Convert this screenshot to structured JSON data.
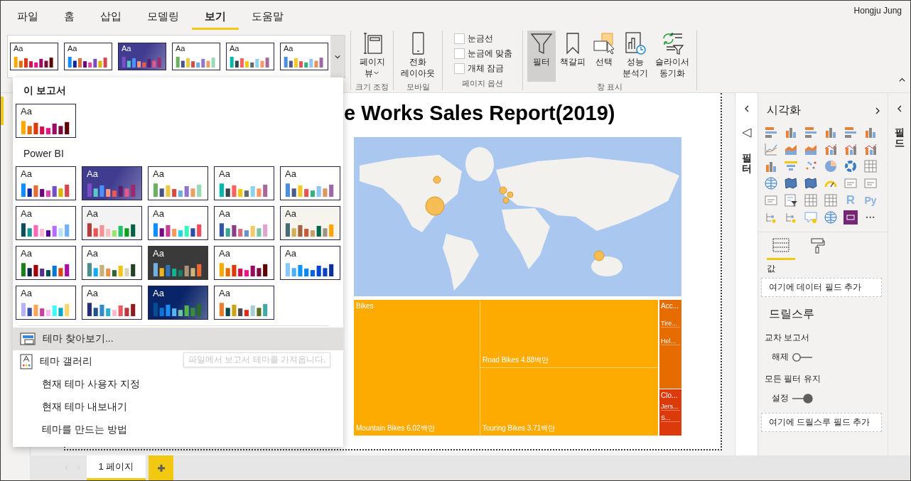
{
  "menu": {
    "tabs": [
      {
        "label": "파일",
        "selected": false
      },
      {
        "label": "홈",
        "selected": false
      },
      {
        "label": "삽입",
        "selected": false
      },
      {
        "label": "모델링",
        "selected": false
      },
      {
        "label": "보기",
        "selected": true
      },
      {
        "label": "도움말",
        "selected": false
      }
    ],
    "user": "Hongju Jung"
  },
  "ribbon": {
    "themes": [
      {
        "label": "Aa",
        "kind": "plain",
        "color": "#ffffff",
        "bars": [
          {
            "color": "#fdaa00"
          },
          {
            "color": "#e66c00"
          },
          {
            "color": "#dd3a0c"
          },
          {
            "color": "#d30f50"
          },
          {
            "color": "#ea1489"
          },
          {
            "color": "#9b0b60"
          },
          {
            "color": "#7b0a3f"
          },
          {
            "color": "#5c0002"
          }
        ]
      },
      {
        "label": "Aa",
        "kind": "plain",
        "color": "#ffffff",
        "bars": [
          {
            "color": "#118dff"
          },
          {
            "color": "#12239e"
          },
          {
            "color": "#e66c37"
          },
          {
            "color": "#6b007b"
          },
          {
            "color": "#e044a7"
          },
          {
            "color": "#744ec2"
          },
          {
            "color": "#d9b300"
          },
          {
            "color": "#d64550"
          }
        ]
      },
      {
        "label": "Aa",
        "kind": "gradient",
        "color": "#403d90",
        "bars": [
          {
            "color": "#7c4dc9"
          },
          {
            "color": "#5ac8c8"
          },
          {
            "color": "#4a90ff"
          },
          {
            "color": "#ff977e"
          },
          {
            "color": "#eb5757"
          },
          {
            "color": "#5b1f6f"
          },
          {
            "color": "#e8578c"
          },
          {
            "color": "#9c2a6c"
          }
        ]
      },
      {
        "label": "Aa",
        "kind": "plain",
        "color": "#ffffff",
        "bars": [
          {
            "color": "#6bb160"
          },
          {
            "color": "#4a5388"
          },
          {
            "color": "#ebc746"
          },
          {
            "color": "#d64b48"
          },
          {
            "color": "#6fade0"
          },
          {
            "color": "#9174d0"
          },
          {
            "color": "#e8a065"
          },
          {
            "color": "#98d9b9"
          }
        ]
      },
      {
        "label": "Aa",
        "kind": "plain",
        "color": "#ffffff",
        "bars": [
          {
            "color": "#01b8aa"
          },
          {
            "color": "#374649"
          },
          {
            "color": "#fd625e"
          },
          {
            "color": "#f2c80f"
          },
          {
            "color": "#5f6b6d"
          },
          {
            "color": "#8ad4eb"
          },
          {
            "color": "#fe9666"
          },
          {
            "color": "#a66999"
          }
        ]
      },
      {
        "label": "Aa",
        "kind": "plain",
        "color": "#ffffff",
        "bars": [
          {
            "color": "#4d8fdf"
          },
          {
            "color": "#4a5b8c"
          },
          {
            "color": "#f5c825"
          },
          {
            "color": "#e05656"
          },
          {
            "color": "#34b17f"
          },
          {
            "color": "#92c5f0"
          },
          {
            "color": "#df955e"
          },
          {
            "color": "#9c69a7"
          }
        ]
      }
    ],
    "groups": [
      {
        "label": "크기 조정",
        "kind": "buttons",
        "items": [
          {
            "kind": "page-view",
            "lines": [
              "페이지",
              "뷰"
            ],
            "dropdown": true,
            "selected": false
          }
        ]
      },
      {
        "label": "모바일",
        "kind": "buttons",
        "items": [
          {
            "kind": "phone",
            "lines": [
              "전화",
              "레이아웃"
            ],
            "dropdown": false,
            "selected": false
          }
        ]
      },
      {
        "label": "페이지 옵션",
        "kind": "checkboxes",
        "items": [
          {
            "label": "눈금선",
            "checked": false
          },
          {
            "label": "눈금에 맞춤",
            "checked": false
          },
          {
            "label": "개체 잠금",
            "checked": false
          }
        ]
      },
      {
        "label": "창 표시",
        "kind": "buttons",
        "items": [
          {
            "kind": "filter",
            "lines": [
              "필터"
            ],
            "dropdown": false,
            "selected": true
          },
          {
            "kind": "bookmark",
            "lines": [
              "책갈피"
            ],
            "dropdown": false,
            "selected": false
          },
          {
            "kind": "selection",
            "lines": [
              "선택"
            ],
            "dropdown": false,
            "selected": false
          },
          {
            "kind": "performance",
            "lines": [
              "성능",
              "분석기"
            ],
            "dropdown": false,
            "selected": false
          },
          {
            "kind": "sync",
            "lines": [
              "슬라이서",
              "동기화"
            ],
            "dropdown": false,
            "selected": false
          }
        ]
      }
    ]
  },
  "page": {
    "title": "e Works Sales Report(2019)",
    "treemap": {
      "groups": [
        {
          "label": "Bikes",
          "color": "#fdab00",
          "tiles": [
            "Mountain Bikes 6.02백만",
            "Road Bikes 4.88백만",
            "Touring Bikes 3.71백만"
          ]
        },
        {
          "label": "Acc...",
          "color": "#e66c00",
          "tiles": [
            "Tire...",
            "Hel..."
          ]
        },
        {
          "label": "Clo...",
          "color": "#dd3a0c",
          "tiles": [
            "Jers...",
            "S..."
          ]
        }
      ]
    }
  },
  "filters_pane": {
    "label": "필터"
  },
  "visualizations": {
    "title": "시각화",
    "icons": [
      {
        "kind": "hbar"
      },
      {
        "kind": "vbar"
      },
      {
        "kind": "hbar"
      },
      {
        "kind": "vbar"
      },
      {
        "kind": "hbar"
      },
      {
        "kind": "vbar"
      },
      {
        "kind": "line"
      },
      {
        "kind": "area"
      },
      {
        "kind": "area"
      },
      {
        "kind": "combo"
      },
      {
        "kind": "combo"
      },
      {
        "kind": "combo"
      },
      {
        "kind": "vbar"
      },
      {
        "kind": "funnel"
      },
      {
        "kind": "scatter"
      },
      {
        "kind": "pie"
      },
      {
        "kind": "donut"
      },
      {
        "kind": "grid"
      },
      {
        "kind": "globe"
      },
      {
        "kind": "map"
      },
      {
        "kind": "map"
      },
      {
        "kind": "gauge"
      },
      {
        "kind": "card"
      },
      {
        "kind": "card"
      },
      {
        "kind": "card"
      },
      {
        "kind": "slicer"
      },
      {
        "kind": "grid"
      },
      {
        "kind": "grid"
      },
      {
        "kind": "letter",
        "text": "R"
      },
      {
        "kind": "letter",
        "text": "Py"
      },
      {
        "kind": "tree"
      },
      {
        "kind": "tree"
      },
      {
        "kind": "speech"
      },
      {
        "kind": "globe"
      },
      {
        "kind": "custom"
      },
      {
        "kind": "letter",
        "text": "···"
      }
    ],
    "tabs": [
      {
        "kind": "fields",
        "selected": true
      },
      {
        "kind": "format",
        "selected": false
      }
    ],
    "values_label": "값",
    "values_hint": "여기에 데이터 필드 추가",
    "drillthrough": {
      "title": "드릴스루",
      "toggles": [
        {
          "label": "교차 보고서",
          "state": "해제",
          "on": false
        },
        {
          "label": "모든 필터 유지",
          "state": "설정",
          "on": true
        }
      ],
      "hint": "여기에 드릴스루 필드 추가"
    }
  },
  "fields_pane": {
    "label": "필드"
  },
  "page_tabs": {
    "tabs": [
      {
        "label": "1 페이지",
        "selected": true
      }
    ]
  },
  "theme_menu": {
    "sections": [
      {
        "title": "이 보고서",
        "themes": [
          {
            "label": "Aa",
            "kind": "plain",
            "color": "#ffffff",
            "bars": [
              {
                "color": "#fdaa00"
              },
              {
                "color": "#e66c00"
              },
              {
                "color": "#dd3a0c"
              },
              {
                "color": "#d30f50"
              },
              {
                "color": "#ea1489"
              },
              {
                "color": "#9b0b60"
              },
              {
                "color": "#7b0a3f"
              },
              {
                "color": "#5c0002"
              }
            ]
          }
        ]
      },
      {
        "title": "Power BI",
        "themes": [
          {
            "label": "Aa",
            "kind": "plain",
            "color": "#ffffff",
            "bars": [
              {
                "color": "#118dff"
              },
              {
                "color": "#12239e"
              },
              {
                "color": "#e66c37"
              },
              {
                "color": "#6b007b"
              },
              {
                "color": "#e044a7"
              },
              {
                "color": "#744ec2"
              },
              {
                "color": "#d9b300"
              },
              {
                "color": "#d64550"
              }
            ]
          },
          {
            "label": "Aa",
            "kind": "gradient",
            "color": "#403d90",
            "bars": [
              {
                "color": "#7c4dc9"
              },
              {
                "color": "#5ac8c8"
              },
              {
                "color": "#4a90ff"
              },
              {
                "color": "#ff977e"
              },
              {
                "color": "#eb5757"
              },
              {
                "color": "#5b1f6f"
              },
              {
                "color": "#e8578c"
              },
              {
                "color": "#9c2a6c"
              }
            ]
          },
          {
            "label": "Aa",
            "kind": "plain",
            "color": "#ffffff",
            "bars": [
              {
                "color": "#6bb160"
              },
              {
                "color": "#4a5388"
              },
              {
                "color": "#ebc746"
              },
              {
                "color": "#d64b48"
              },
              {
                "color": "#6fade0"
              },
              {
                "color": "#9174d0"
              },
              {
                "color": "#e8a065"
              },
              {
                "color": "#98d9b9"
              }
            ]
          },
          {
            "label": "Aa",
            "kind": "plain",
            "color": "#ffffff",
            "bars": [
              {
                "color": "#01b8aa"
              },
              {
                "color": "#374649"
              },
              {
                "color": "#fd625e"
              },
              {
                "color": "#f2c80f"
              },
              {
                "color": "#5f6b6d"
              },
              {
                "color": "#8ad4eb"
              },
              {
                "color": "#fe9666"
              },
              {
                "color": "#a66999"
              }
            ]
          },
          {
            "label": "Aa",
            "kind": "plain",
            "color": "#ffffff",
            "bars": [
              {
                "color": "#4d8fdf"
              },
              {
                "color": "#4a5b8c"
              },
              {
                "color": "#f5c825"
              },
              {
                "color": "#e05656"
              },
              {
                "color": "#34b17f"
              },
              {
                "color": "#92c5f0"
              },
              {
                "color": "#df955e"
              },
              {
                "color": "#9c69a7"
              }
            ]
          },
          {
            "label": "Aa",
            "kind": "plain",
            "color": "#ffffff",
            "bars": [
              {
                "color": "#0f4c5c"
              },
              {
                "color": "#0e9594"
              },
              {
                "color": "#fe66bb"
              },
              {
                "color": "#f9b6d4"
              },
              {
                "color": "#4f0795"
              },
              {
                "color": "#b46efb"
              },
              {
                "color": "#bee1fd"
              },
              {
                "color": "#6fb2fd"
              }
            ]
          },
          {
            "label": "Aa",
            "kind": "plain",
            "color": "#f3f3f3",
            "bars": [
              {
                "color": "#b33c3e"
              },
              {
                "color": "#ec5354"
              },
              {
                "color": "#f39194"
              },
              {
                "color": "#f7bfbe"
              },
              {
                "color": "#9ae46c"
              },
              {
                "color": "#24c06b"
              },
              {
                "color": "#0aa01a"
              },
              {
                "color": "#066046"
              }
            ]
          },
          {
            "label": "Aa",
            "kind": "plain",
            "color": "#ffffff",
            "bars": [
              {
                "color": "#118dff"
              },
              {
                "color": "#750985"
              },
              {
                "color": "#c83d95"
              },
              {
                "color": "#ff985e"
              },
              {
                "color": "#1ddae6"
              },
              {
                "color": "#3bf5c1"
              },
              {
                "color": "#2f4bac"
              },
              {
                "color": "#f04e5e"
              }
            ]
          },
          {
            "label": "Aa",
            "kind": "plain",
            "color": "#ffffff",
            "bars": [
              {
                "color": "#3257a8"
              },
              {
                "color": "#37a794"
              },
              {
                "color": "#8b3d88"
              },
              {
                "color": "#dd6b7f"
              },
              {
                "color": "#6b91c9"
              },
              {
                "color": "#f5c869"
              },
              {
                "color": "#77c4a8"
              },
              {
                "color": "#dea6cf"
              }
            ]
          },
          {
            "label": "Aa",
            "kind": "plain",
            "color": "#f6f4ed",
            "bars": [
              {
                "color": "#486a76"
              },
              {
                "color": "#d1b155"
              },
              {
                "color": "#a3633f"
              },
              {
                "color": "#c55a3a"
              },
              {
                "color": "#c39e6c"
              },
              {
                "color": "#01684d"
              },
              {
                "color": "#9f9286"
              },
              {
                "color": "#ffa500"
              }
            ]
          },
          {
            "label": "Aa",
            "kind": "plain",
            "color": "#ffffff",
            "bars": [
              {
                "color": "#1b7f1b"
              },
              {
                "color": "#0c2449"
              },
              {
                "color": "#a10008"
              },
              {
                "color": "#5b2c90"
              },
              {
                "color": "#04524d"
              },
              {
                "color": "#0b78d0"
              },
              {
                "color": "#dd4a0f"
              },
              {
                "color": "#a80da6"
              }
            ]
          },
          {
            "label": "Aa",
            "kind": "plain",
            "color": "#ffffff",
            "bars": [
              {
                "color": "#4a8e8e"
              },
              {
                "color": "#14aaf5"
              },
              {
                "color": "#c6b07c"
              },
              {
                "color": "#ef904a"
              },
              {
                "color": "#336235"
              },
              {
                "color": "#f2c515"
              },
              {
                "color": "#d8d4bc"
              },
              {
                "color": "#224226"
              }
            ]
          },
          {
            "label": "Aa",
            "kind": "plain",
            "color": "#3a3a3a",
            "bars": [
              {
                "color": "#73b0e0"
              },
              {
                "color": "#f2b31a"
              },
              {
                "color": "#2e75b8"
              },
              {
                "color": "#13b092"
              },
              {
                "color": "#128061"
              },
              {
                "color": "#ad937a"
              },
              {
                "color": "#ccb57f"
              },
              {
                "color": "#f36730"
              }
            ]
          },
          {
            "label": "Aa",
            "kind": "plain",
            "color": "#ffffff",
            "bars": [
              {
                "color": "#fdaa00"
              },
              {
                "color": "#e66c00"
              },
              {
                "color": "#dd3a0c"
              },
              {
                "color": "#d30f50"
              },
              {
                "color": "#ea1489"
              },
              {
                "color": "#9b0b60"
              },
              {
                "color": "#7b0a3f"
              },
              {
                "color": "#5c0002"
              }
            ]
          },
          {
            "label": "Aa",
            "kind": "plain",
            "color": "#ffffff",
            "bars": [
              {
                "color": "#8ac6ff"
              },
              {
                "color": "#48b1ff"
              },
              {
                "color": "#0d94ff"
              },
              {
                "color": "#0a86ec"
              },
              {
                "color": "#0064e6"
              },
              {
                "color": "#0448cf"
              },
              {
                "color": "#0a42c1"
              },
              {
                "color": "#0e2f9b"
              }
            ]
          },
          {
            "label": "Aa",
            "kind": "plain",
            "color": "#ffffff",
            "bars": [
              {
                "color": "#b8b2fb"
              },
              {
                "color": "#344da9"
              },
              {
                "color": "#fca458"
              },
              {
                "color": "#c8409c"
              },
              {
                "color": "#fabaec"
              },
              {
                "color": "#3ef9f6"
              },
              {
                "color": "#05a7c4"
              },
              {
                "color": "#fdd46a"
              }
            ]
          },
          {
            "label": "Aa",
            "kind": "plain",
            "color": "#ffffff",
            "bars": [
              {
                "color": "#292e7b"
              },
              {
                "color": "#21548d"
              },
              {
                "color": "#318bcb"
              },
              {
                "color": "#29b0d3"
              },
              {
                "color": "#fdbdce"
              },
              {
                "color": "#ec5a67"
              },
              {
                "color": "#b7393f"
              },
              {
                "color": "#901d1d"
              }
            ]
          },
          {
            "label": "Aa",
            "kind": "gradient",
            "color": "#0a2469",
            "bars": [
              {
                "color": "#064e92"
              },
              {
                "color": "#0d75d8"
              },
              {
                "color": "#198ef5"
              },
              {
                "color": "#56b4f5"
              },
              {
                "color": "#70c2a0"
              },
              {
                "color": "#51b44c"
              },
              {
                "color": "#3a8a37"
              },
              {
                "color": "#2b6b2b"
              }
            ]
          },
          {
            "label": "Aa",
            "kind": "plain",
            "color": "#ffffff",
            "bars": [
              {
                "color": "#f07c2b"
              },
              {
                "color": "#004c4c"
              },
              {
                "color": "#c9a518"
              },
              {
                "color": "#4a4a4a"
              },
              {
                "color": "#d62d1e"
              },
              {
                "color": "#a5cfd5"
              },
              {
                "color": "#58701c"
              },
              {
                "color": "#46a8a8"
              }
            ]
          }
        ]
      }
    ],
    "items": [
      {
        "label": "테마 찾아보기...",
        "kind": "browse",
        "hovered": true
      },
      {
        "label": "테마 갤러리",
        "kind": "gallery",
        "hovered": false
      },
      {
        "label": "현재 테마 사용자 지정",
        "kind": "plain",
        "hovered": false
      },
      {
        "label": "현재 테마 내보내기",
        "kind": "plain",
        "hovered": false
      },
      {
        "label": "테마를 만드는 방법",
        "kind": "plain",
        "hovered": false
      }
    ],
    "tooltip": "파일에서 보고서 테마를 가져옵니다."
  }
}
